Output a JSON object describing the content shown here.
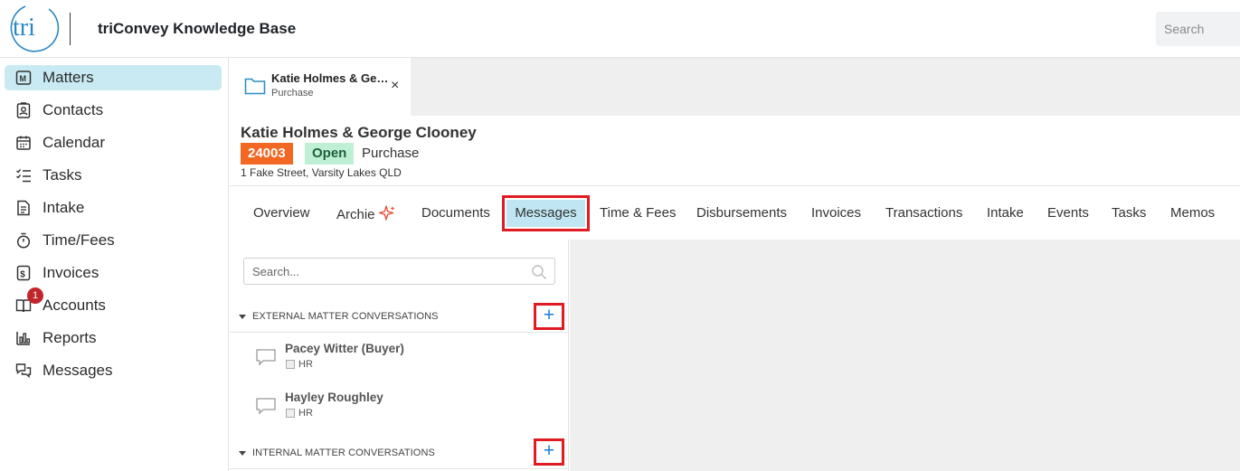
{
  "header": {
    "logo_text": "tri",
    "app_title": "triConvey Knowledge Base",
    "search_placeholder": "Search"
  },
  "sidebar": {
    "items": [
      {
        "label": "Matters",
        "icon": "matters-icon",
        "active": true
      },
      {
        "label": "Contacts",
        "icon": "contacts-icon"
      },
      {
        "label": "Calendar",
        "icon": "calendar-icon"
      },
      {
        "label": "Tasks",
        "icon": "tasks-icon"
      },
      {
        "label": "Intake",
        "icon": "intake-icon"
      },
      {
        "label": "Time/Fees",
        "icon": "stopwatch-icon"
      },
      {
        "label": "Invoices",
        "icon": "invoice-icon"
      },
      {
        "label": "Accounts",
        "icon": "accounts-icon",
        "badge": "1"
      },
      {
        "label": "Reports",
        "icon": "reports-icon"
      },
      {
        "label": "Messages",
        "icon": "messages-icon"
      }
    ]
  },
  "matter_tab": {
    "title": "Katie Holmes & George Clooney",
    "subtitle": "Purchase",
    "close": "×"
  },
  "matter": {
    "title": "Katie Holmes & George Clooney",
    "number": "24003",
    "status": "Open",
    "type": "Purchase",
    "address": "1 Fake Street, Varsity Lakes QLD"
  },
  "subtabs": [
    "Overview",
    "Archie",
    "Documents",
    "Messages",
    "Time & Fees",
    "Disbursements",
    "Invoices",
    "Transactions",
    "Intake",
    "Events",
    "Tasks",
    "Memos"
  ],
  "active_subtab": "Messages",
  "messages": {
    "search_placeholder": "Search...",
    "external_label": "EXTERNAL MATTER CONVERSATIONS",
    "internal_label": "INTERNAL MATTER CONVERSATIONS",
    "add_label": "+",
    "conversations": [
      {
        "name": "Pacey Witter (Buyer)",
        "tag": "HR"
      },
      {
        "name": "Hayley Roughley",
        "tag": "HR"
      }
    ]
  },
  "colors": {
    "accent_active": "#c9eaf3",
    "matter_number_bg": "#f26722",
    "status_open_bg": "#bff0d6",
    "highlight_border": "#e01b22",
    "badge": "#c0272d",
    "add_icon": "#1a7bd6"
  }
}
